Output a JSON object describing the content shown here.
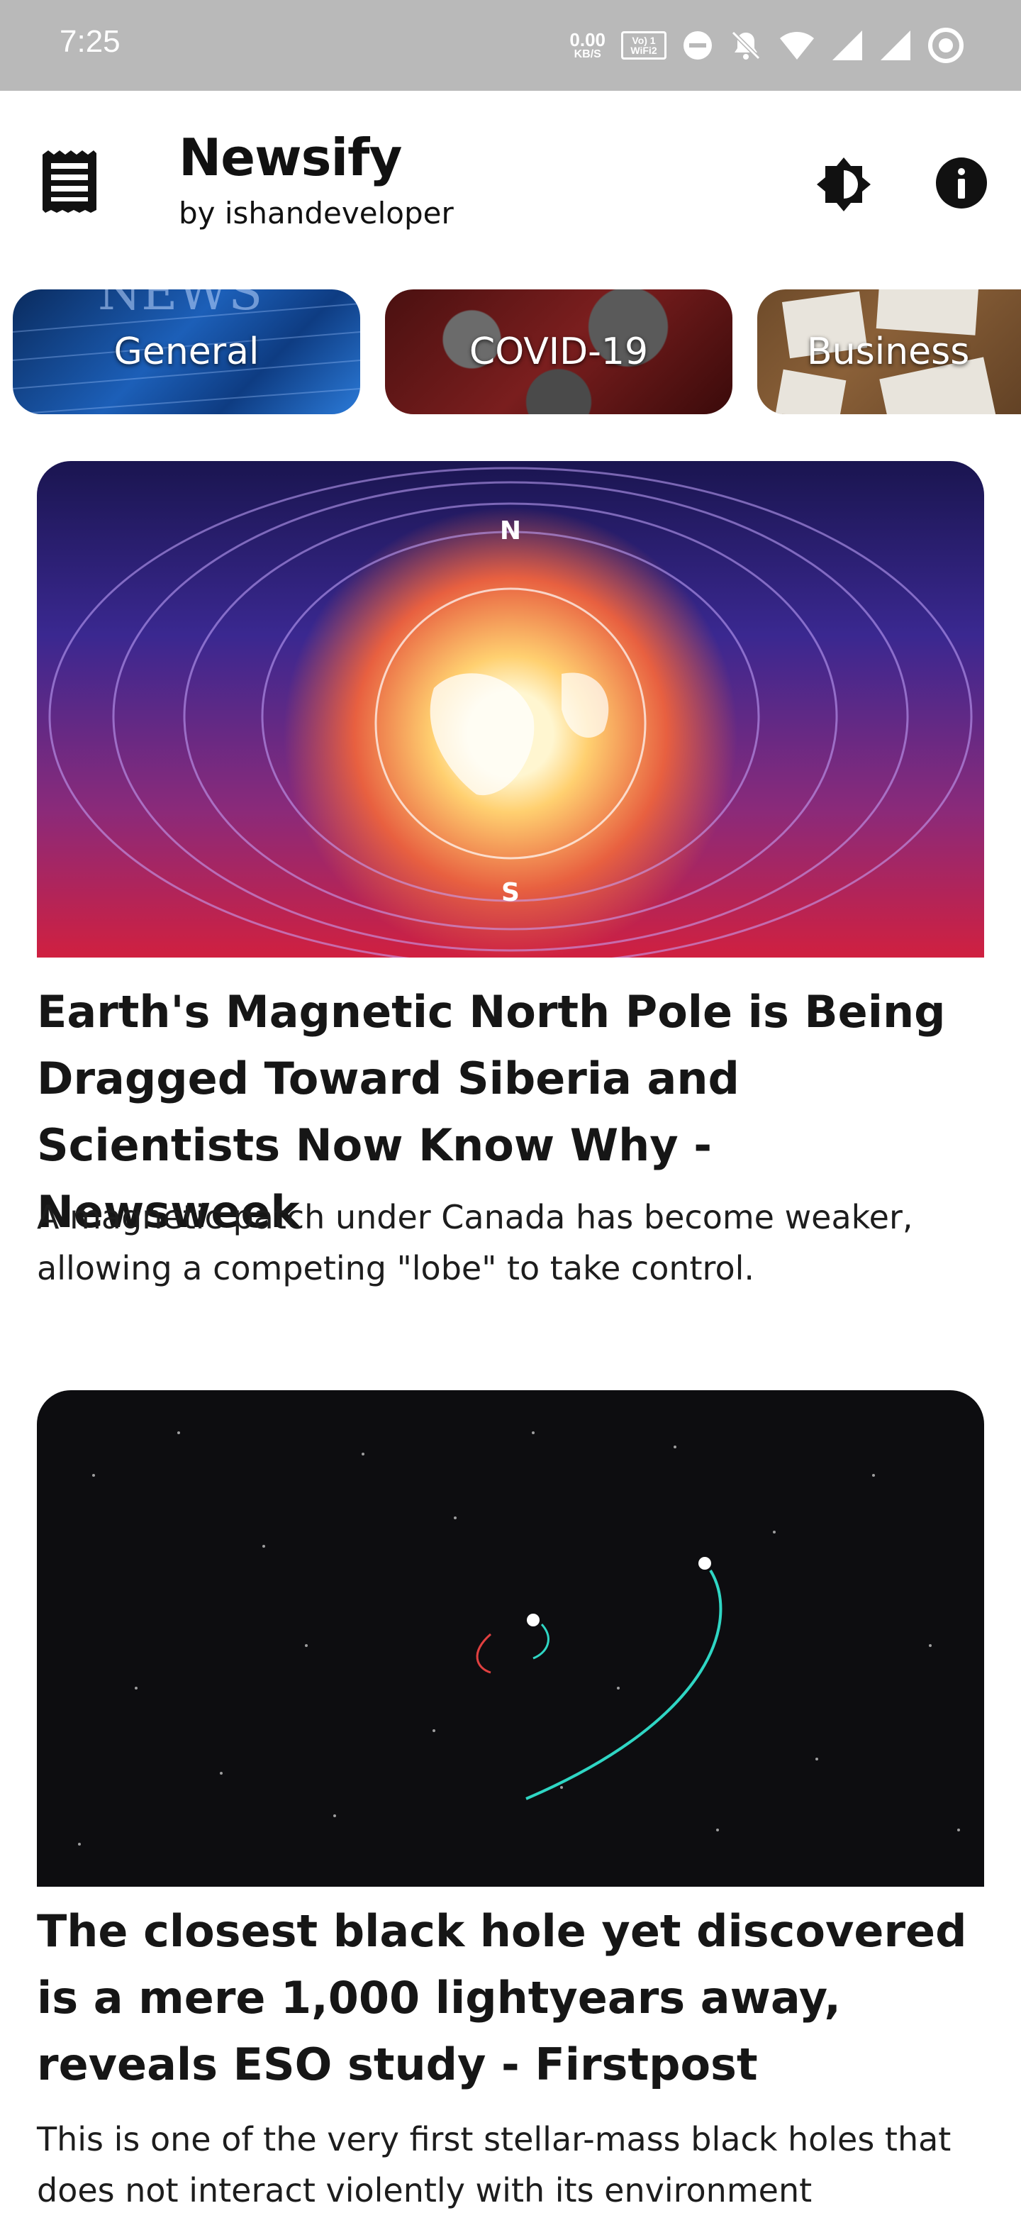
{
  "status_bar": {
    "time": "7:25",
    "net_speed_value": "0.00",
    "net_speed_unit": "KB/S",
    "wifi_badge": "Vo) 1 WiFi2",
    "icons": [
      "net-speed-icon",
      "volte-wifi-icon",
      "dnd-icon",
      "mute-icon",
      "wifi-icon",
      "signal-icon",
      "signal-icon-2",
      "sync-icon"
    ]
  },
  "header": {
    "title": "Newsify",
    "subtitle": "by ishandeveloper",
    "menu_icon": "menu-icon",
    "theme_icon": "brightness-icon",
    "info_icon": "info-icon"
  },
  "categories": [
    {
      "label": "General"
    },
    {
      "label": "COVID-19"
    },
    {
      "label": "Business"
    }
  ],
  "articles": [
    {
      "title": "Earth's Magnetic North Pole is Being Dragged Toward Siberia and Scientists Now Know Why - Newsweek",
      "description": "A magnetic patch under Canada has become weaker, allowing a competing \"lobe\" to take control.",
      "image_labels": {
        "north": "N",
        "south": "S"
      }
    },
    {
      "title": "The closest black hole yet discovered is a mere 1,000 lightyears away, reveals ESO study - Firstpost",
      "description": "This is one of the very first stellar-mass black holes that does not interact violently with its environment"
    }
  ],
  "colors": {
    "status_bar": "#b9b9b9",
    "background": "#ffffff",
    "text": "#111111"
  }
}
